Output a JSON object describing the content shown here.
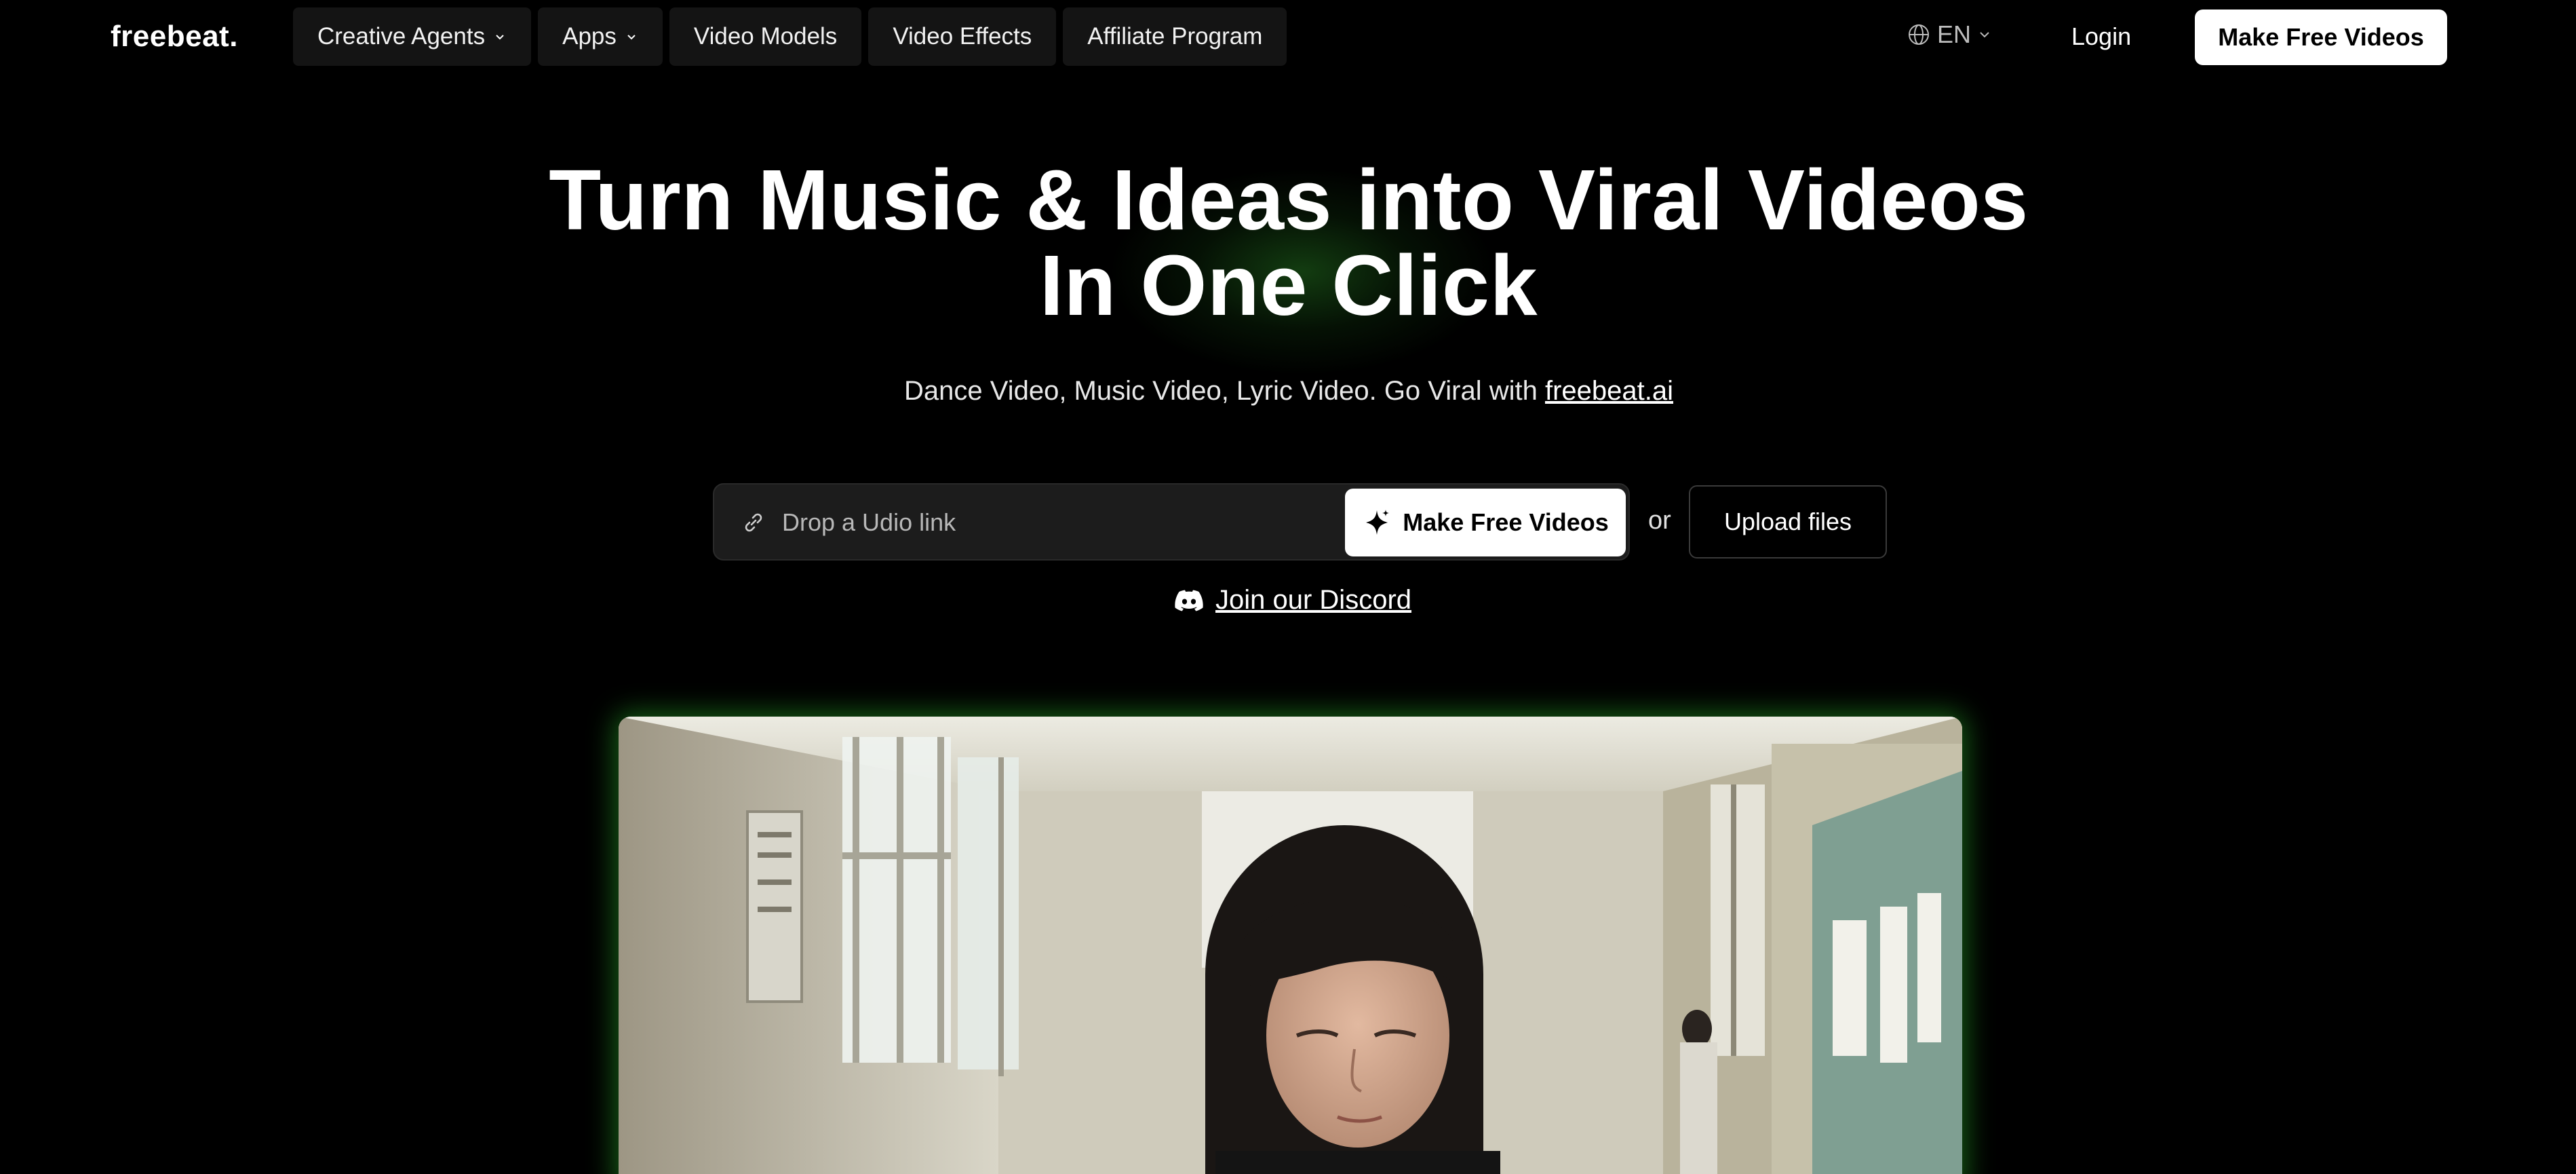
{
  "brand": {
    "logo_text": "freebeat."
  },
  "nav": {
    "items": [
      {
        "label": "Creative Agents",
        "has_dropdown": true
      },
      {
        "label": "Apps",
        "has_dropdown": true
      },
      {
        "label": "Video Models",
        "has_dropdown": false
      },
      {
        "label": "Video Effects",
        "has_dropdown": false
      },
      {
        "label": "Affiliate Program",
        "has_dropdown": false
      }
    ],
    "language": "EN",
    "login_label": "Login",
    "cta_label": "Make Free Videos"
  },
  "hero": {
    "title_line1": "Turn Music & Ideas into Viral Videos",
    "title_line2": "In One Click",
    "subtitle_prefix": "Dance Video, Music Video, Lyric Video. Go Viral with ",
    "subtitle_link": "freebeat.ai",
    "input_placeholder": "Drop a Udio link",
    "input_value": "",
    "cta_label": "Make Free Videos",
    "or_label": "or",
    "upload_label": "Upload files",
    "discord_label": "Join our Discord"
  },
  "colors": {
    "background": "#000000",
    "accent_glow": "#28aa28",
    "button_bg": "#ffffff",
    "button_text": "#000000"
  },
  "icons": [
    "globe-icon",
    "chevron-down-icon",
    "link-icon",
    "sparkle-icon",
    "discord-icon"
  ]
}
